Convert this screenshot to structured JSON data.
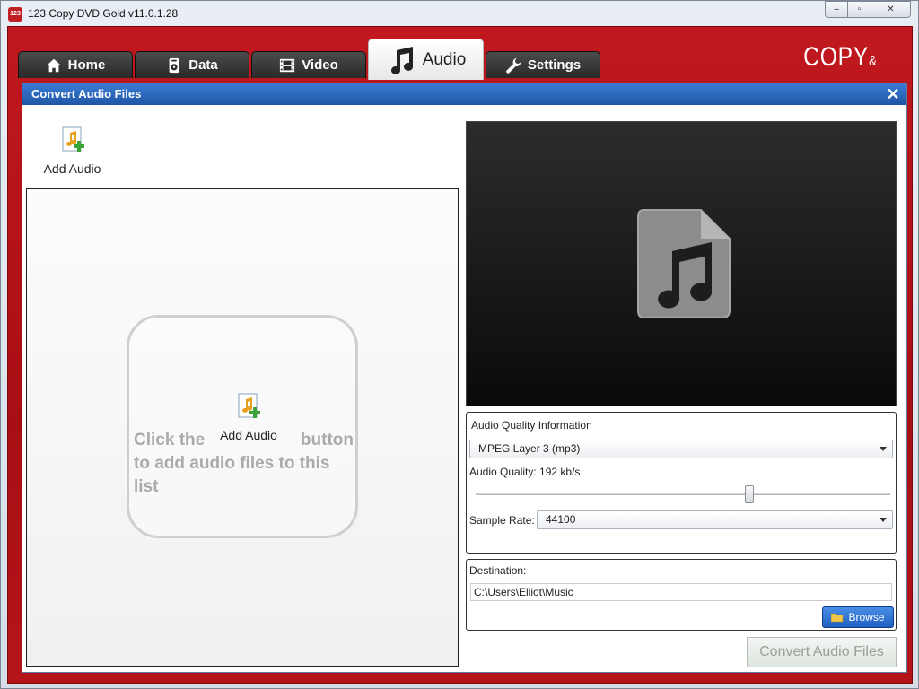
{
  "window": {
    "title": "123 Copy DVD Gold v11.0.1.28",
    "app_icon_text": "123",
    "caption_buttons": {
      "minimize": "–",
      "restore": "▫",
      "close": "✕"
    }
  },
  "brand": {
    "text": "COPY",
    "suffix": "&"
  },
  "tabs": [
    {
      "label": "Home",
      "icon": "home-icon",
      "active": false
    },
    {
      "label": "Data",
      "icon": "data-disc-icon",
      "active": false
    },
    {
      "label": "Video",
      "icon": "film-icon",
      "active": false
    },
    {
      "label": "Audio",
      "icon": "music-note-icon",
      "active": true
    },
    {
      "label": "Settings",
      "icon": "wrench-icon",
      "active": false
    }
  ],
  "dialog": {
    "title": "Convert Audio Files",
    "close": "✕",
    "add_audio_label": "Add Audio",
    "hint": {
      "prefix": "Click the",
      "button_label": "Add Audio",
      "suffix": "button",
      "line2": "to add audio files to this list"
    }
  },
  "quality": {
    "section_title": "Audio Quality Information",
    "format_selected": "MPEG Layer 3 (mp3)",
    "quality_label": "Audio Quality: 192 kb/s",
    "quality_level_fraction": 0.66,
    "sample_rate_label": "Sample Rate:",
    "sample_rate_selected": "44100"
  },
  "destination": {
    "label": "Destination:",
    "path": "C:\\Users\\Elliot\\Music",
    "browse_label": "Browse"
  },
  "convert_button_label": "Convert Audio Files",
  "colors": {
    "brand_red": "#b3151a",
    "dialog_header_blue": "#2a68bf",
    "browse_blue": "#2c6fd1"
  }
}
